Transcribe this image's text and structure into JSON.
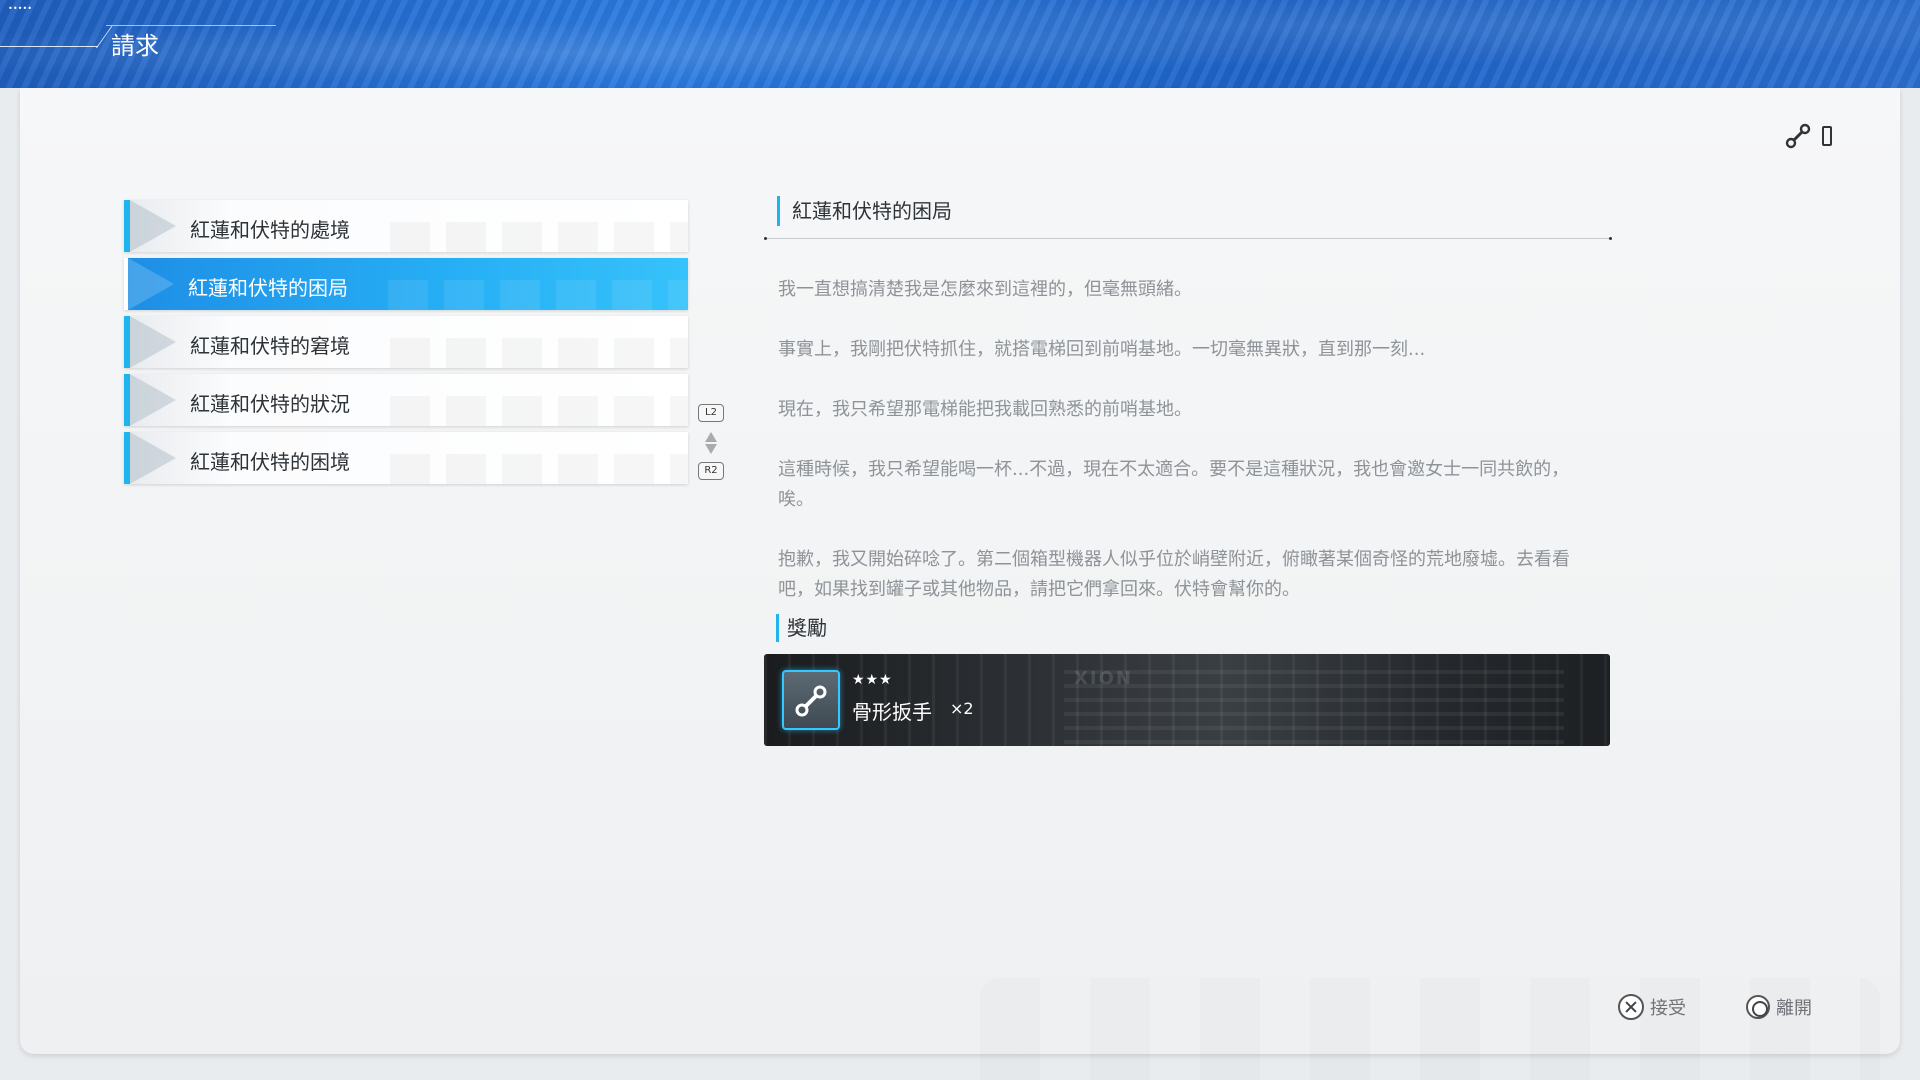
{
  "header": {
    "status_signal": "•••••",
    "title": "請求"
  },
  "quest_list": {
    "selected_index": 1,
    "items": [
      {
        "label": "紅蓮和伏特的處境"
      },
      {
        "label": "紅蓮和伏特的困局"
      },
      {
        "label": "紅蓮和伏特的窘境"
      },
      {
        "label": "紅蓮和伏特的狀況"
      },
      {
        "label": "紅蓮和伏特的困境"
      }
    ],
    "scroll_up_button": "L2",
    "scroll_down_button": "R2"
  },
  "detail": {
    "title": "紅蓮和伏特的困局",
    "paragraphs": [
      "我一直想搞清楚我是怎麼來到這裡的，但毫無頭緒。",
      "事實上，我剛把伏特抓住，就搭電梯回到前哨基地。一切毫無異狀，直到那一刻...",
      "現在，我只希望那電梯能把我載回熟悉的前哨基地。",
      "這種時候，我只希望能喝一杯...不過，現在不太適合。要不是這種狀況，我也會邀女士一同共飲的，唉。",
      "抱歉，我又開始碎唸了。第二個箱型機器人似乎位於峭壁附近，俯瞰著某個奇怪的荒地廢墟。去看看吧，如果找到罐子或其他物品，請把它們拿回來。伏特會幫你的。"
    ]
  },
  "reward": {
    "label": "獎勵",
    "background_text": "XION",
    "stars": "★★★",
    "item_name": "骨形扳手",
    "item_quantity": "×2",
    "item_icon": "bone-wrench-icon",
    "accent_color": "#33c8ff"
  },
  "actions": {
    "accept_label": "接受",
    "leave_label": "離開"
  },
  "colors": {
    "accent": "#1fb4ee",
    "selected_row": "#27b0f5",
    "banner": "#2a7ae0"
  }
}
